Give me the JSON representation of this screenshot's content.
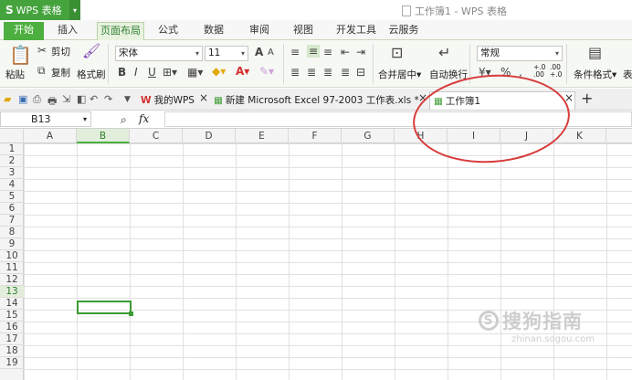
{
  "app": {
    "menu_button": "WPS 表格",
    "logo_glyph": "S",
    "window_title": "工作簿1 - WPS 表格"
  },
  "tabs": [
    "开始",
    "插入",
    "页面布局",
    "公式",
    "数据",
    "审阅",
    "视图",
    "开发工具",
    "云服务"
  ],
  "active_tab": "开始",
  "ribbon": {
    "paste": "粘贴",
    "cut": "剪切",
    "copy": "复制",
    "format_painter": "格式刷",
    "font_name": "宋体",
    "font_size": "11",
    "merge_center": "合并居中",
    "auto_wrap": "自动换行",
    "number_format": "常规",
    "percent": "%",
    "conditional_format": "条件格式",
    "table_style_partial": "表",
    "bold": "B",
    "italic": "I",
    "underline": "U",
    "grow_font": "A",
    "shrink_font": "A",
    "font_color": "A",
    "dec_inc": "+.0 .00",
    "dec_dec": ".00 +.0"
  },
  "doc_tabs": {
    "my_wps": "我的WPS",
    "excel_file": "新建 Microsoft Excel 97-2003 工作表.xls *",
    "workbook": "工作簿1",
    "new_tab": "+"
  },
  "formula_bar": {
    "cell_ref": "B13",
    "fx": "fx",
    "value": ""
  },
  "columns": [
    "A",
    "B",
    "C",
    "D",
    "E",
    "F",
    "G",
    "H",
    "I",
    "J",
    "K"
  ],
  "rows": [
    "1",
    "2",
    "3",
    "4",
    "5",
    "6",
    "7",
    "8",
    "9",
    "10",
    "11",
    "12",
    "13",
    "14",
    "15",
    "16",
    "17",
    "18",
    "19"
  ],
  "selected_cell": {
    "column": "B",
    "row": "13"
  },
  "watermark": {
    "logo": "S",
    "text": "搜狗指南",
    "url": "zhinan.sogou.com"
  },
  "colors": {
    "accent_green": "#4caf3f",
    "annotation_red": "#d83b3b"
  }
}
